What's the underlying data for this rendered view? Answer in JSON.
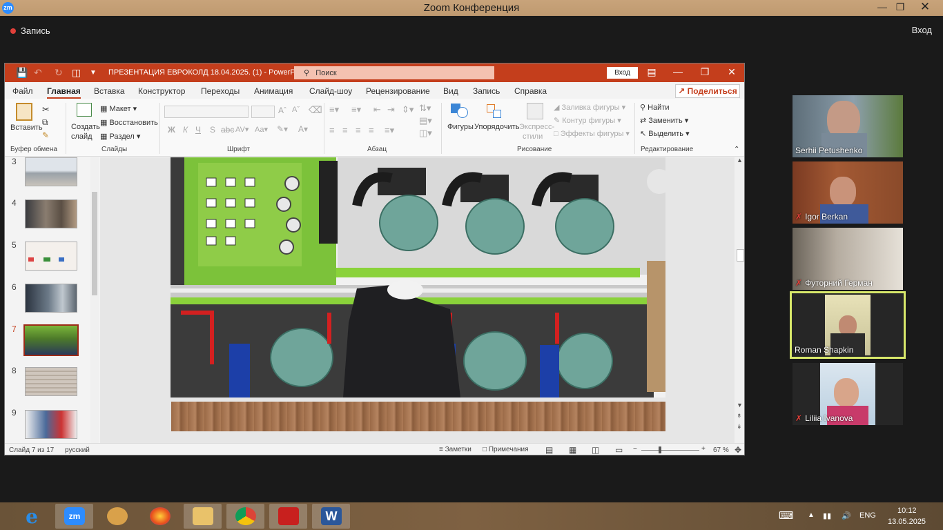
{
  "zoom": {
    "window_title": "Zoom Конференция",
    "logo": "zm",
    "recording_label": "Запись",
    "exit_label": "Вход"
  },
  "ppt": {
    "doc_title": "ПРЕЗЕНТАЦИЯ ЕВРОКОЛД 18.04.2025. (1)  -  PowerPoint",
    "search_placeholder": "Поиск",
    "signin_label": "Вход",
    "tabs": [
      "Файл",
      "Главная",
      "Вставка",
      "Конструктор",
      "Переходы",
      "Анимация",
      "Слайд-шоу",
      "Рецензирование",
      "Вид",
      "Запись",
      "Справка"
    ],
    "share_label": "Поделиться",
    "ribbon": {
      "paste": "Вставить",
      "clipboard_group": "Буфер обмена",
      "new_slide_1": "Создать",
      "new_slide_2": "слайд",
      "layout": "Макет",
      "reset": "Восстановить",
      "section": "Раздел",
      "slides_group": "Слайды",
      "font_group": "Шрифт",
      "paragraph_group": "Абзац",
      "shapes": "Фигуры",
      "arrange": "Упорядочить",
      "quick_styles_1": "Экспресс-",
      "quick_styles_2": "стили",
      "shape_fill": "Заливка фигуры",
      "shape_outline": "Контур фигуры",
      "shape_effects": "Эффекты фигуры",
      "drawing_group": "Рисование",
      "find": "Найти",
      "replace": "Заменить",
      "select": "Выделить",
      "editing_group": "Редактирование"
    },
    "thumbnails": [
      {
        "num": "3"
      },
      {
        "num": "4"
      },
      {
        "num": "5"
      },
      {
        "num": "6"
      },
      {
        "num": "7"
      },
      {
        "num": "8"
      },
      {
        "num": "9"
      }
    ],
    "status": {
      "slide_info": "Слайд 7 из 17",
      "language": "русский",
      "notes": "Заметки",
      "comments": "Примечания",
      "zoom": "67 %"
    }
  },
  "participants": [
    {
      "name": "Serhii Petushenko",
      "muted": false
    },
    {
      "name": "Igor Berkan",
      "muted": true
    },
    {
      "name": "Футорний Герман",
      "muted": true
    },
    {
      "name": "Roman Shapkin",
      "muted": false,
      "active_speaker": true
    },
    {
      "name": "Liliia Ivanova",
      "muted": true
    }
  ],
  "taskbar": {
    "apps": [
      "internet-explorer",
      "zoom",
      "outlook",
      "firefox",
      "file-explorer",
      "chrome",
      "acrobat",
      "word"
    ],
    "zoom_label": "zm",
    "word_label": "W",
    "language": "ENG",
    "time": "10:12",
    "date": "13.05.2025"
  },
  "colors": {
    "ppt_accent": "#c43e1c",
    "active_speaker_border": "#d8e86a",
    "zoom_blue": "#2d8cff"
  }
}
